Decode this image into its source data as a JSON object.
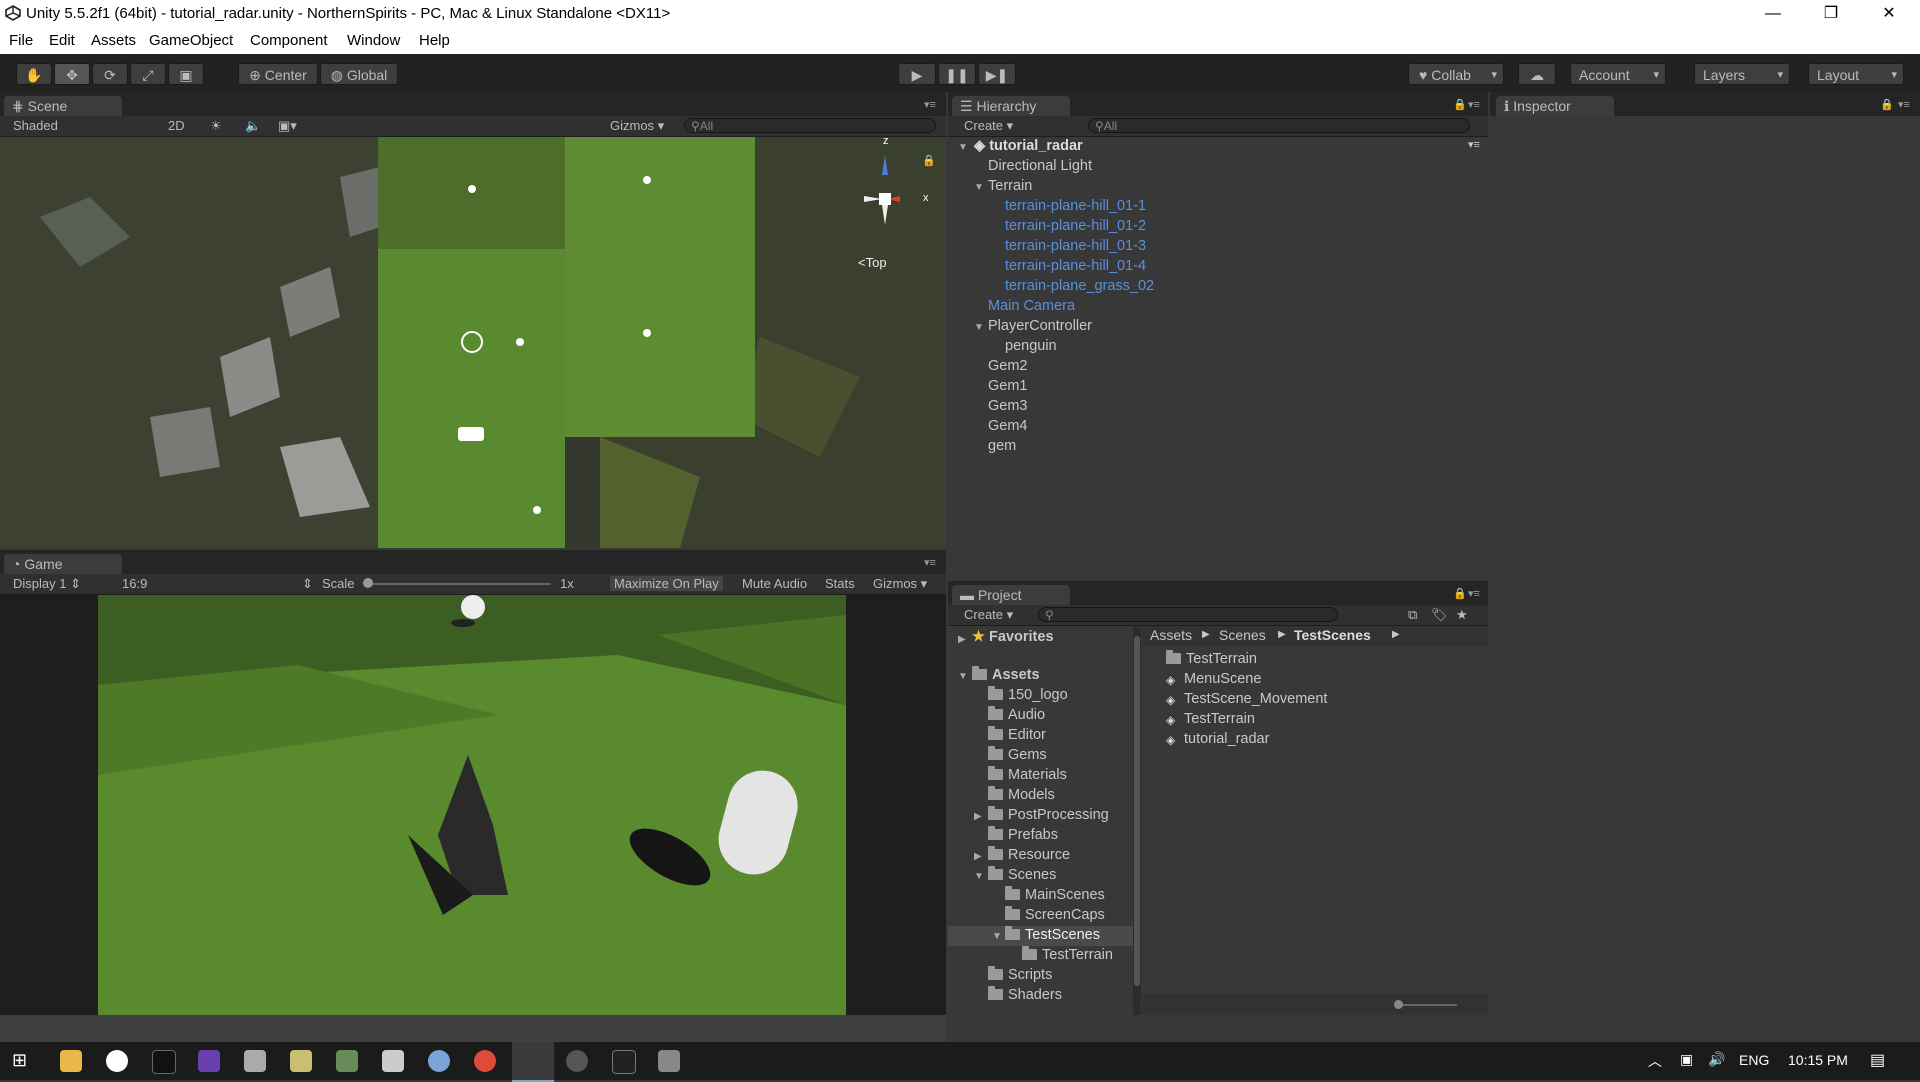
{
  "window": {
    "title": "Unity 5.5.2f1 (64bit) - tutorial_radar.unity - NorthernSpirits - PC, Mac & Linux Standalone <DX11>",
    "minimize": "—",
    "restore": "❐",
    "close": "✕"
  },
  "menu": [
    "File",
    "Edit",
    "Assets",
    "GameObject",
    "Component",
    "Window",
    "Help"
  ],
  "toolbar": {
    "pivot": "Center",
    "space": "Global",
    "collab": "Collab",
    "account": "Account",
    "layers": "Layers",
    "layout": "Layout",
    "tools": [
      "hand-icon",
      "move-icon",
      "rotate-icon",
      "scale-icon",
      "rect-icon"
    ]
  },
  "scene": {
    "tab": "Scene",
    "shading": "Shaded",
    "mode2d": "2D",
    "gizmos": "Gizmos",
    "search": "All",
    "view": "Top",
    "axis_z": "z",
    "axis_x": "x"
  },
  "game": {
    "tab": "Game",
    "display": "Display 1",
    "aspect": "16:9",
    "scale_label": "Scale",
    "scale_value": "1x",
    "maximize": "Maximize On Play",
    "mute": "Mute Audio",
    "stats": "Stats",
    "gizmos": "Gizmos"
  },
  "hierarchy": {
    "tab": "Hierarchy",
    "create": "Create",
    "search": "All",
    "scene": "tutorial_radar",
    "items": [
      {
        "label": "Directional Light"
      },
      {
        "label": "Terrain"
      },
      {
        "label": "terrain-plane-hill_01-1"
      },
      {
        "label": "terrain-plane-hill_01-2"
      },
      {
        "label": "terrain-plane-hill_01-3"
      },
      {
        "label": "terrain-plane-hill_01-4"
      },
      {
        "label": "terrain-plane_grass_02"
      },
      {
        "label": "Main Camera"
      },
      {
        "label": "PlayerController"
      },
      {
        "label": "penguin"
      },
      {
        "label": "Gem2"
      },
      {
        "label": "Gem1"
      },
      {
        "label": "Gem3"
      },
      {
        "label": "Gem4"
      },
      {
        "label": "gem"
      }
    ]
  },
  "inspector": {
    "tab": "Inspector"
  },
  "project": {
    "tab": "Project",
    "create": "Create",
    "favorites": "Favorites",
    "assets": "Assets",
    "tree": [
      "150_logo",
      "Audio",
      "Editor",
      "Gems",
      "Materials",
      "Models",
      "PostProcessing",
      "Prefabs",
      "Resource",
      "Scenes",
      "MainScenes",
      "ScreenCaps",
      "TestScenes",
      "TestTerrain",
      "Scripts",
      "Shaders"
    ],
    "breadcrumb": [
      "Assets",
      "Scenes",
      "TestScenes"
    ],
    "files": [
      "TestTerrain",
      "MenuScene",
      "TestScene_Movement",
      "TestTerrain",
      "tutorial_radar"
    ]
  },
  "taskbar": {
    "lang": "ENG",
    "time": "10:15 PM"
  },
  "colors": {
    "accent_blue": "#5a8fe0",
    "panel": "#383838",
    "grass": "#5f8a36"
  }
}
